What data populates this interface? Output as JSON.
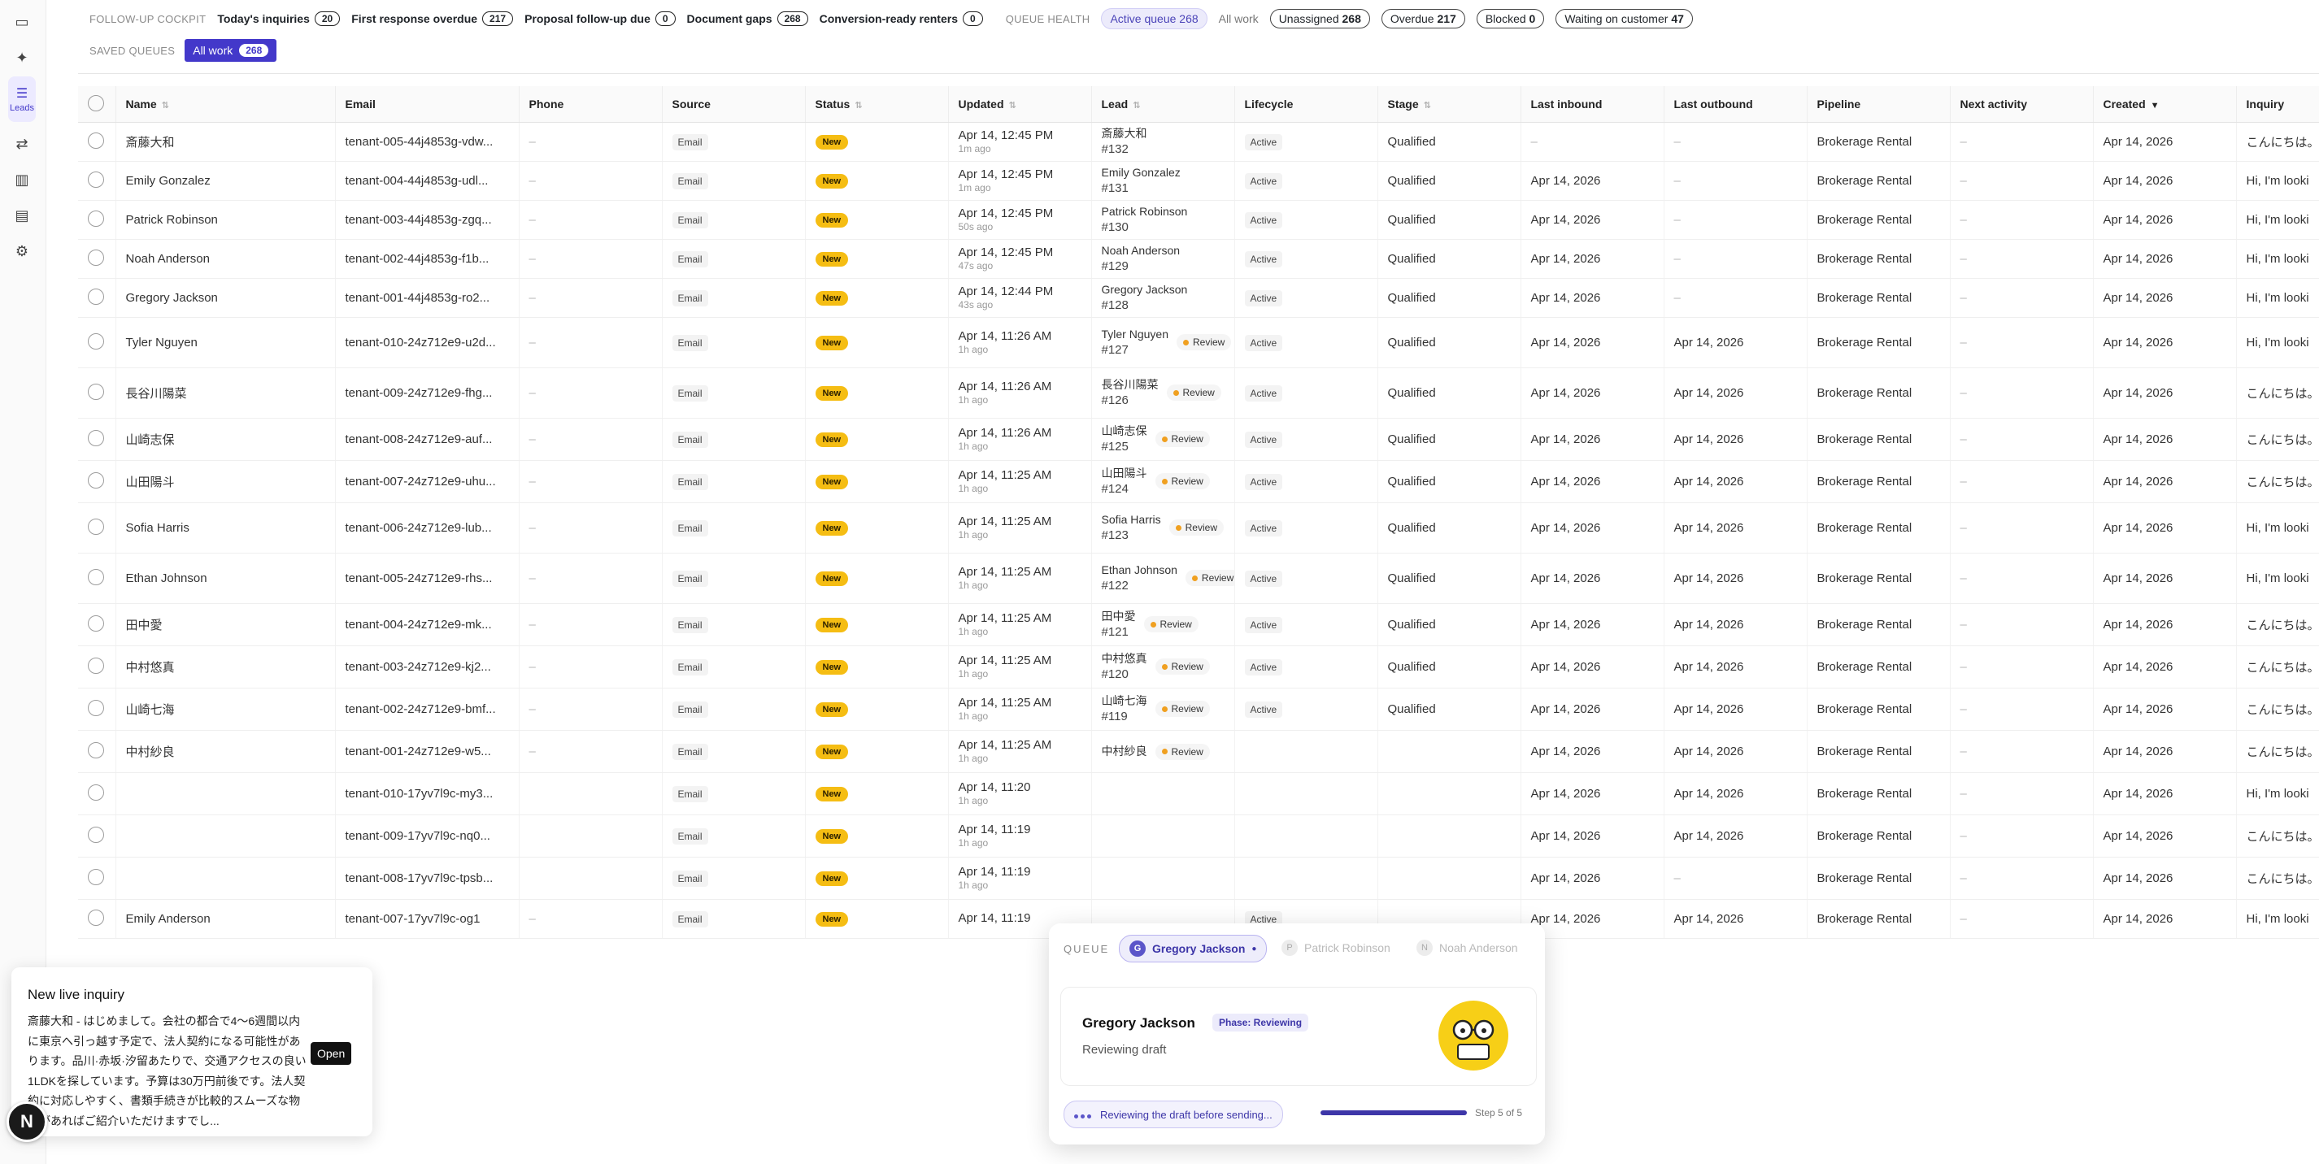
{
  "rail": {
    "active_label": "Leads"
  },
  "top": {
    "cockpit_label": "FOLLOW-UP COCKPIT",
    "chips": [
      {
        "label": "Today's inquiries",
        "count": "20"
      },
      {
        "label": "First response overdue",
        "count": "217"
      },
      {
        "label": "Proposal follow-up due",
        "count": "0"
      },
      {
        "label": "Document gaps",
        "count": "268"
      },
      {
        "label": "Conversion-ready renters",
        "count": "0"
      }
    ],
    "queue_health_label": "QUEUE HEALTH",
    "active_queue": "Active queue 268",
    "all_work": "All work",
    "health": [
      {
        "label": "Unassigned",
        "count": "268"
      },
      {
        "label": "Overdue",
        "count": "217"
      },
      {
        "label": "Blocked",
        "count": "0"
      },
      {
        "label": "Waiting on customer",
        "count": "47"
      }
    ],
    "saved_queues_label": "SAVED QUEUES",
    "saved_queue": {
      "label": "All work",
      "count": "268"
    }
  },
  "columns": [
    "Name",
    "Email",
    "Phone",
    "Source",
    "Status",
    "Updated",
    "Lead",
    "Lifecycle",
    "Stage",
    "Last inbound",
    "Last outbound",
    "Pipeline",
    "Next activity",
    "Created",
    "Inquiry"
  ],
  "rows": [
    {
      "name": "斎藤大和",
      "email": "tenant-005-44j4853g-vdw...",
      "phone": "–",
      "source": "Email",
      "status": "New",
      "updated": "Apr 14, 12:45 PM",
      "ago": "1m ago",
      "lead_name": "斎藤大和",
      "lead_num": "#132",
      "review": "",
      "lifecycle": "Active",
      "stage": "Qualified",
      "last_in": "–",
      "last_out": "–",
      "pipeline": "Brokerage Rental",
      "next": "–",
      "created": "Apr 14, 2026",
      "inquiry": "こんにちは。"
    },
    {
      "name": "Emily Gonzalez",
      "email": "tenant-004-44j4853g-udl...",
      "phone": "–",
      "source": "Email",
      "status": "New",
      "updated": "Apr 14, 12:45 PM",
      "ago": "1m ago",
      "lead_name": "Emily Gonzalez",
      "lead_num": "#131",
      "review": "",
      "lifecycle": "Active",
      "stage": "Qualified",
      "last_in": "Apr 14, 2026",
      "last_out": "–",
      "pipeline": "Brokerage Rental",
      "next": "–",
      "created": "Apr 14, 2026",
      "inquiry": "Hi, I'm looki"
    },
    {
      "name": "Patrick Robinson",
      "email": "tenant-003-44j4853g-zgq...",
      "phone": "–",
      "source": "Email",
      "status": "New",
      "updated": "Apr 14, 12:45 PM",
      "ago": "50s ago",
      "lead_name": "Patrick Robinson",
      "lead_num": "#130",
      "review": "",
      "lifecycle": "Active",
      "stage": "Qualified",
      "last_in": "Apr 14, 2026",
      "last_out": "–",
      "pipeline": "Brokerage Rental",
      "next": "–",
      "created": "Apr 14, 2026",
      "inquiry": "Hi, I'm looki"
    },
    {
      "name": "Noah Anderson",
      "email": "tenant-002-44j4853g-f1b...",
      "phone": "–",
      "source": "Email",
      "status": "New",
      "updated": "Apr 14, 12:45 PM",
      "ago": "47s ago",
      "lead_name": "Noah Anderson",
      "lead_num": "#129",
      "review": "",
      "lifecycle": "Active",
      "stage": "Qualified",
      "last_in": "Apr 14, 2026",
      "last_out": "–",
      "pipeline": "Brokerage Rental",
      "next": "–",
      "created": "Apr 14, 2026",
      "inquiry": "Hi, I'm looki"
    },
    {
      "name": "Gregory Jackson",
      "email": "tenant-001-44j4853g-ro2...",
      "phone": "–",
      "source": "Email",
      "status": "New",
      "updated": "Apr 14, 12:44 PM",
      "ago": "43s ago",
      "lead_name": "Gregory Jackson",
      "lead_num": "#128",
      "review": "",
      "lifecycle": "Active",
      "stage": "Qualified",
      "last_in": "Apr 14, 2026",
      "last_out": "–",
      "pipeline": "Brokerage Rental",
      "next": "–",
      "created": "Apr 14, 2026",
      "inquiry": "Hi, I'm looki"
    },
    {
      "name": "Tyler Nguyen",
      "email": "tenant-010-24z712e9-u2d...",
      "phone": "–",
      "source": "Email",
      "status": "New",
      "updated": "Apr 14, 11:26 AM",
      "ago": "1h ago",
      "lead_name": "Tyler Nguyen",
      "lead_num": "#127",
      "review": "Review",
      "lifecycle": "Active",
      "stage": "Qualified",
      "last_in": "Apr 14, 2026",
      "last_out": "Apr 14, 2026",
      "pipeline": "Brokerage Rental",
      "next": "–",
      "created": "Apr 14, 2026",
      "inquiry": "Hi, I'm looki"
    },
    {
      "name": "長谷川陽菜",
      "email": "tenant-009-24z712e9-fhg...",
      "phone": "–",
      "source": "Email",
      "status": "New",
      "updated": "Apr 14, 11:26 AM",
      "ago": "1h ago",
      "lead_name": "長谷川陽菜",
      "lead_num": "#126",
      "review": "Review",
      "lifecycle": "Active",
      "stage": "Qualified",
      "last_in": "Apr 14, 2026",
      "last_out": "Apr 14, 2026",
      "pipeline": "Brokerage Rental",
      "next": "–",
      "created": "Apr 14, 2026",
      "inquiry": "こんにちは。"
    },
    {
      "name": "山崎志保",
      "email": "tenant-008-24z712e9-auf...",
      "phone": "–",
      "source": "Email",
      "status": "New",
      "updated": "Apr 14, 11:26 AM",
      "ago": "1h ago",
      "lead_name": "山崎志保",
      "lead_num": "#125",
      "review": "Review",
      "lifecycle": "Active",
      "stage": "Qualified",
      "last_in": "Apr 14, 2026",
      "last_out": "Apr 14, 2026",
      "pipeline": "Brokerage Rental",
      "next": "–",
      "created": "Apr 14, 2026",
      "inquiry": "こんにちは。"
    },
    {
      "name": "山田陽斗",
      "email": "tenant-007-24z712e9-uhu...",
      "phone": "–",
      "source": "Email",
      "status": "New",
      "updated": "Apr 14, 11:25 AM",
      "ago": "1h ago",
      "lead_name": "山田陽斗",
      "lead_num": "#124",
      "review": "Review",
      "lifecycle": "Active",
      "stage": "Qualified",
      "last_in": "Apr 14, 2026",
      "last_out": "Apr 14, 2026",
      "pipeline": "Brokerage Rental",
      "next": "–",
      "created": "Apr 14, 2026",
      "inquiry": "こんにちは。"
    },
    {
      "name": "Sofia Harris",
      "email": "tenant-006-24z712e9-lub...",
      "phone": "–",
      "source": "Email",
      "status": "New",
      "updated": "Apr 14, 11:25 AM",
      "ago": "1h ago",
      "lead_name": "Sofia Harris",
      "lead_num": "#123",
      "review": "Review",
      "lifecycle": "Active",
      "stage": "Qualified",
      "last_in": "Apr 14, 2026",
      "last_out": "Apr 14, 2026",
      "pipeline": "Brokerage Rental",
      "next": "–",
      "created": "Apr 14, 2026",
      "inquiry": "Hi, I'm looki"
    },
    {
      "name": "Ethan Johnson",
      "email": "tenant-005-24z712e9-rhs...",
      "phone": "–",
      "source": "Email",
      "status": "New",
      "updated": "Apr 14, 11:25 AM",
      "ago": "1h ago",
      "lead_name": "Ethan Johnson",
      "lead_num": "#122",
      "review": "Review",
      "lifecycle": "Active",
      "stage": "Qualified",
      "last_in": "Apr 14, 2026",
      "last_out": "Apr 14, 2026",
      "pipeline": "Brokerage Rental",
      "next": "–",
      "created": "Apr 14, 2026",
      "inquiry": "Hi, I'm looki"
    },
    {
      "name": "田中愛",
      "email": "tenant-004-24z712e9-mk...",
      "phone": "–",
      "source": "Email",
      "status": "New",
      "updated": "Apr 14, 11:25 AM",
      "ago": "1h ago",
      "lead_name": "田中愛",
      "lead_num": "#121",
      "review": "Review",
      "lifecycle": "Active",
      "stage": "Qualified",
      "last_in": "Apr 14, 2026",
      "last_out": "Apr 14, 2026",
      "pipeline": "Brokerage Rental",
      "next": "–",
      "created": "Apr 14, 2026",
      "inquiry": "こんにちは。"
    },
    {
      "name": "中村悠真",
      "email": "tenant-003-24z712e9-kj2...",
      "phone": "–",
      "source": "Email",
      "status": "New",
      "updated": "Apr 14, 11:25 AM",
      "ago": "1h ago",
      "lead_name": "中村悠真",
      "lead_num": "#120",
      "review": "Review",
      "lifecycle": "Active",
      "stage": "Qualified",
      "last_in": "Apr 14, 2026",
      "last_out": "Apr 14, 2026",
      "pipeline": "Brokerage Rental",
      "next": "–",
      "created": "Apr 14, 2026",
      "inquiry": "こんにちは。"
    },
    {
      "name": "山崎七海",
      "email": "tenant-002-24z712e9-bmf...",
      "phone": "–",
      "source": "Email",
      "status": "New",
      "updated": "Apr 14, 11:25 AM",
      "ago": "1h ago",
      "lead_name": "山崎七海",
      "lead_num": "#119",
      "review": "Review",
      "lifecycle": "Active",
      "stage": "Qualified",
      "last_in": "Apr 14, 2026",
      "last_out": "Apr 14, 2026",
      "pipeline": "Brokerage Rental",
      "next": "–",
      "created": "Apr 14, 2026",
      "inquiry": "こんにちは。"
    },
    {
      "name": "中村紗良",
      "email": "tenant-001-24z712e9-w5...",
      "phone": "–",
      "source": "Email",
      "status": "New",
      "updated": "Apr 14, 11:25 AM",
      "ago": "1h ago",
      "lead_name": "中村紗良",
      "lead_num": "",
      "review": "Review",
      "lifecycle": "",
      "stage": "",
      "last_in": "Apr 14, 2026",
      "last_out": "Apr 14, 2026",
      "pipeline": "Brokerage Rental",
      "next": "–",
      "created": "Apr 14, 2026",
      "inquiry": "こんにちは。"
    },
    {
      "name": "",
      "email": "tenant-010-17yv7l9c-my3...",
      "phone": "",
      "source": "Email",
      "status": "New",
      "updated": "Apr 14, 11:20",
      "ago": "1h ago",
      "lead_name": "",
      "lead_num": "",
      "review": "",
      "lifecycle": "",
      "stage": "",
      "last_in": "Apr 14, 2026",
      "last_out": "Apr 14, 2026",
      "pipeline": "Brokerage Rental",
      "next": "–",
      "created": "Apr 14, 2026",
      "inquiry": "Hi, I'm looki"
    },
    {
      "name": "",
      "email": "tenant-009-17yv7l9c-nq0...",
      "phone": "",
      "source": "Email",
      "status": "New",
      "updated": "Apr 14, 11:19",
      "ago": "1h ago",
      "lead_name": "",
      "lead_num": "",
      "review": "",
      "lifecycle": "",
      "stage": "",
      "last_in": "Apr 14, 2026",
      "last_out": "Apr 14, 2026",
      "pipeline": "Brokerage Rental",
      "next": "–",
      "created": "Apr 14, 2026",
      "inquiry": "こんにちは。"
    },
    {
      "name": "",
      "email": "tenant-008-17yv7l9c-tpsb...",
      "phone": "",
      "source": "Email",
      "status": "New",
      "updated": "Apr 14, 11:19",
      "ago": "1h ago",
      "lead_name": "",
      "lead_num": "",
      "review": "",
      "lifecycle": "",
      "stage": "",
      "last_in": "Apr 14, 2026",
      "last_out": "–",
      "pipeline": "Brokerage Rental",
      "next": "–",
      "created": "Apr 14, 2026",
      "inquiry": "こんにちは。"
    },
    {
      "name": "Emily Anderson",
      "email": "tenant-007-17yv7l9c-og1",
      "phone": "–",
      "source": "Email",
      "status": "New",
      "updated": "Apr 14, 11:19",
      "ago": "",
      "lead_name": "",
      "lead_num": "",
      "review": "",
      "lifecycle": "Active",
      "stage": "",
      "last_in": "Apr 14, 2026",
      "last_out": "Apr 14, 2026",
      "pipeline": "Brokerage Rental",
      "next": "–",
      "created": "Apr 14, 2026",
      "inquiry": "Hi, I'm looki"
    }
  ],
  "toast": {
    "title": "New live inquiry",
    "body": "斎藤大和 - はじめまして。会社の都合で4～6週間以内に東京へ引っ越す予定で、法人契約になる可能性があります。品川·赤坂·汐留あたりで、交通アクセスの良い1LDKを探しています。予算は30万円前後です。法人契約に対応しやすく、書類手続きが比較的スムーズな物件があればご紹介いただけますでし...",
    "open_label": "Open",
    "bubble": "N"
  },
  "queue": {
    "label": "QUEUE",
    "tabs": [
      {
        "initial": "G",
        "name": "Gregory Jackson"
      },
      {
        "initial": "P",
        "name": "Patrick Robinson"
      },
      {
        "initial": "N",
        "name": "Noah Anderson"
      }
    ],
    "card_name": "Gregory Jackson",
    "phase": "Phase: Reviewing",
    "sub": "Reviewing draft",
    "status": "Reviewing the draft before sending...",
    "step": "Step 5 of 5",
    "progress": 1.0
  }
}
